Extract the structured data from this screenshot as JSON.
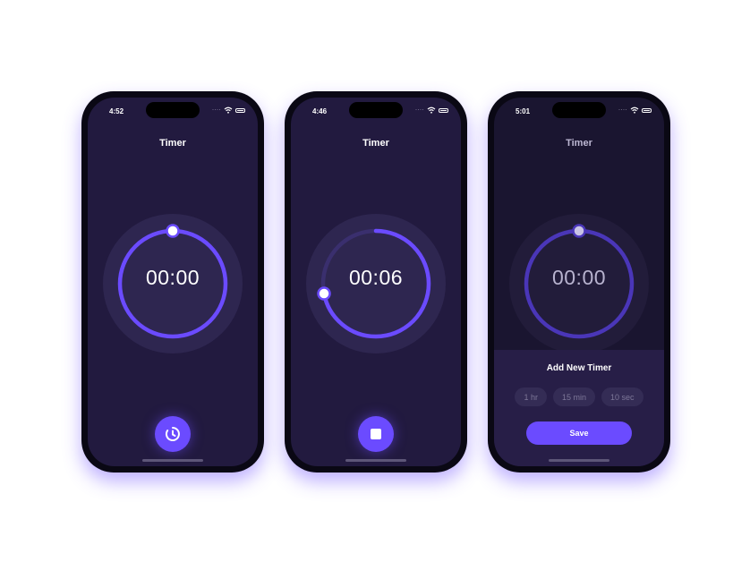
{
  "colors": {
    "accent": "#6b4bff",
    "screen_background": "#221a3f",
    "track": "#2e2650"
  },
  "screens": [
    {
      "status_time": "4:52",
      "title": "Timer",
      "time": "00:00",
      "progress": 1.0,
      "action_icon": "timer-start-icon"
    },
    {
      "status_time": "4:46",
      "title": "Timer",
      "time": "00:06",
      "progress": 0.72,
      "action_icon": "stop-icon"
    },
    {
      "status_time": "5:01",
      "title": "Timer",
      "time": "00:00",
      "progress": 1.0,
      "sheet": {
        "title": "Add New Timer",
        "presets": [
          "1 hr",
          "15 min",
          "10 sec"
        ],
        "save_label": "Save"
      }
    }
  ]
}
